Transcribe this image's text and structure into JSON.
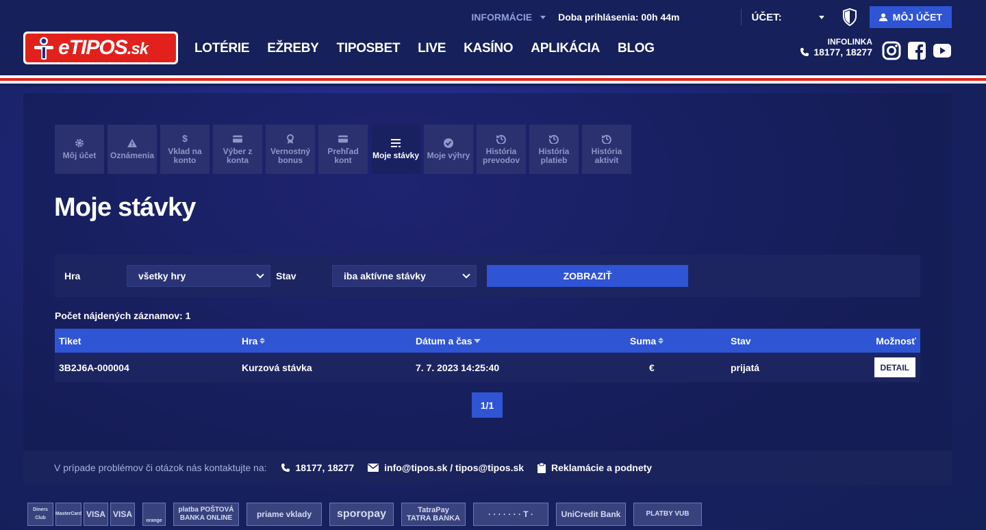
{
  "header": {
    "info_label": "INFORMÁCIE",
    "session": "Doba prihlásenia: 00h 44m",
    "account_label": "ÚČET:",
    "my_account": "MÔJ ÚČET",
    "logo_text": "eTIPOS",
    "logo_suffix": ".sk",
    "nav": [
      "LOTÉRIE",
      "EŽREBY",
      "TIPOSBET",
      "LIVE",
      "KASÍNO",
      "APLIKÁCIA",
      "BLOG"
    ],
    "infolinka_label": "INFOLINKA",
    "infolinka_numbers": "18177, 18277",
    "social": [
      "instagram-icon",
      "facebook-icon",
      "youtube-icon"
    ]
  },
  "subnav": [
    {
      "label": "Môj účet",
      "icon": "gear-icon"
    },
    {
      "label": "Oznámenia",
      "icon": "warning-icon"
    },
    {
      "label": "Vklad na konto",
      "icon": "dollar-icon"
    },
    {
      "label": "Výber z konta",
      "icon": "card-icon"
    },
    {
      "label": "Vernostný bonus",
      "icon": "medal-icon"
    },
    {
      "label": "Prehľad kont",
      "icon": "card-icon"
    },
    {
      "label": "Moje stávky",
      "icon": "list-icon",
      "active": true
    },
    {
      "label": "Moje výhry",
      "icon": "check-circle-icon"
    },
    {
      "label": "História prevodov",
      "icon": "history-icon"
    },
    {
      "label": "História platieb",
      "icon": "history-icon"
    },
    {
      "label": "História aktivít",
      "icon": "history-icon"
    }
  ],
  "page_title": "Moje stávky",
  "filter": {
    "game_label": "Hra",
    "game_value": "všetky hry",
    "status_label": "Stav",
    "status_value": "iba aktívne stávky",
    "submit": "ZOBRAZIŤ"
  },
  "records_count": "Počet nájdených záznamov: 1",
  "table": {
    "headers": {
      "ticket": "Tiket",
      "game": "Hra",
      "date": "Dátum a čas",
      "sum": "Suma",
      "status": "Stav",
      "options": "Možnosť"
    },
    "rows": [
      {
        "ticket": "3B2J6A-000004",
        "game": "Kurzová stávka",
        "date": "7. 7. 2023 14:25:40",
        "sum": "€",
        "status": "prijatá",
        "action": "DETAIL"
      }
    ]
  },
  "pagination": "1/1",
  "contact": {
    "text": "V prípade problémov či otázok nás kontaktujte na:",
    "phone": "18177, 18277",
    "email": "info@tipos.sk / tipos@tipos.sk",
    "complaints": "Reklamácie a podnety"
  },
  "payments": [
    "Diners Club",
    "MasterCard",
    "VISA",
    "VISA",
    "orange",
    "platba POŠTOVÁ BANKA ONLINE",
    "priame vklady",
    "sporopay",
    "TatraPay TATRA BANKA",
    "· · · · · · · T ·",
    "UniCredit Bank",
    "PLATBY VUB"
  ],
  "colors": {
    "accent": "#2f55d4",
    "brand_red": "#e2211c",
    "header_bg": "#16205a"
  }
}
